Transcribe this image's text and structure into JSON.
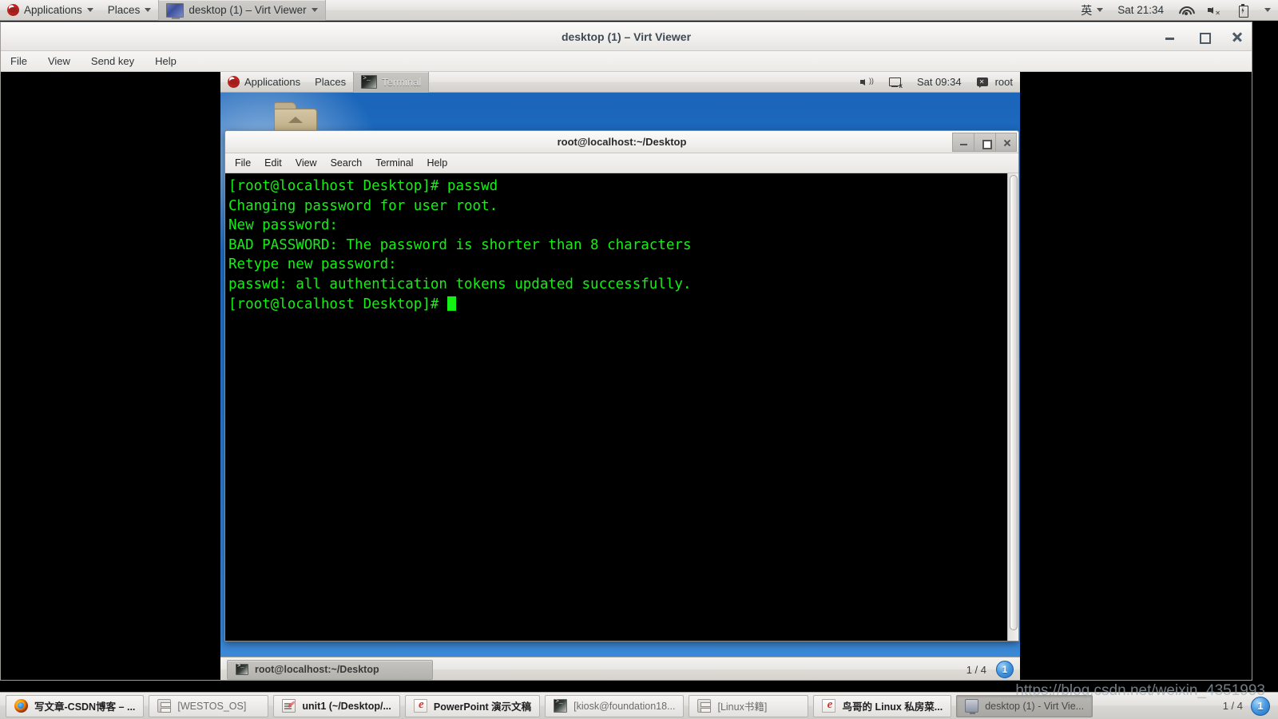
{
  "host_panel": {
    "applications_label": "Applications",
    "places_label": "Places",
    "active_task_label": "desktop (1) – Virt Viewer",
    "language_indicator": "英",
    "clock": "Sat 21:34",
    "icons": [
      "redhat-logo",
      "wifi-icon",
      "speaker-muted-icon",
      "battery-charging-icon"
    ]
  },
  "virt_viewer": {
    "title": "desktop (1) – Virt Viewer",
    "menu": [
      "File",
      "View",
      "Send key",
      "Help"
    ],
    "window_buttons": [
      "minimize",
      "maximize",
      "close"
    ]
  },
  "guest": {
    "panel": {
      "applications_label": "Applications",
      "places_label": "Places",
      "task_label": "Terminal",
      "clock": "Sat 09:34",
      "user_label": "root"
    },
    "desktop_icons": [
      {
        "name": "home-folder",
        "label": ""
      }
    ],
    "bottom_panel": {
      "task_label": "root@localhost:~/Desktop",
      "workspace_count": "1 / 4",
      "workspace_orb": "1"
    }
  },
  "terminal": {
    "title": "root@localhost:~/Desktop",
    "menu": [
      "File",
      "Edit",
      "View",
      "Search",
      "Terminal",
      "Help"
    ],
    "lines": [
      "[root@localhost Desktop]# passwd",
      "Changing password for user root.",
      "New password:",
      "BAD PASSWORD: The password is shorter than 8 characters",
      "Retype new password:",
      "passwd: all authentication tokens updated successfully.",
      "[root@localhost Desktop]# "
    ],
    "text_color": "#13f013",
    "background_color": "#000000"
  },
  "host_taskbar": {
    "items": [
      {
        "label": "写文章-CSDN博客 – ...",
        "icon": "firefox-icon",
        "state": "normal"
      },
      {
        "label": "[WESTOS_OS]",
        "icon": "archive-icon",
        "state": "inactive"
      },
      {
        "label": "unit1 (~/Desktop/...",
        "icon": "gedit-icon",
        "state": "normal"
      },
      {
        "label": "PowerPoint 演示文稿",
        "icon": "powerpoint-icon",
        "state": "normal"
      },
      {
        "label": "[kiosk@foundation18...",
        "icon": "terminal-icon",
        "state": "inactive"
      },
      {
        "label": "[Linux书籍]",
        "icon": "archive-icon",
        "state": "inactive"
      },
      {
        "label": "鸟哥的 Linux 私房菜...",
        "icon": "powerpoint-icon",
        "state": "normal"
      },
      {
        "label": "desktop (1) - Virt Vie...",
        "icon": "vm-icon",
        "state": "pressed"
      }
    ],
    "workspace_count": "1 / 4",
    "workspace_orb": "1"
  },
  "watermark": {
    "text": "https://blog.csdn.net/weixin_4351993"
  }
}
